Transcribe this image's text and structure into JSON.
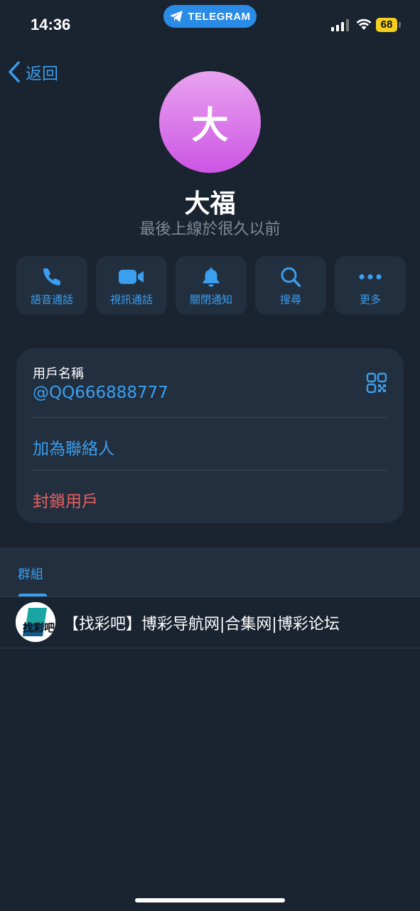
{
  "status_bar": {
    "time": "14:36",
    "app_pill": "TELEGRAM",
    "battery_level": "68"
  },
  "header": {
    "back_label": "返回"
  },
  "profile": {
    "avatar_initial": "大",
    "name": "大福",
    "status": "最後上線於很久以前"
  },
  "actions": [
    {
      "label": "語音通話",
      "icon": "phone-icon"
    },
    {
      "label": "視訊通話",
      "icon": "video-camera-icon"
    },
    {
      "label": "關閉通知",
      "icon": "bell-icon"
    },
    {
      "label": "搜尋",
      "icon": "search-icon"
    },
    {
      "label": "更多",
      "icon": "more-dots-icon"
    }
  ],
  "info_card": {
    "username_label": "用戶名稱",
    "username_value": "@QQ666888777",
    "add_contact": "加為聯絡人",
    "block_user": "封鎖用戶"
  },
  "tabs": {
    "groups_label": "群組"
  },
  "groups": [
    {
      "title": "【找彩吧】博彩导航网|合集网|博彩论坛",
      "avatar_text": "找彩吧"
    }
  ],
  "colors": {
    "background": "#1a2330",
    "card": "#222f3f",
    "accent": "#3b9eee",
    "danger": "#e8605e",
    "avatar_gradient_top": "#e9a3f0",
    "avatar_gradient_bottom": "#cc55e4"
  }
}
